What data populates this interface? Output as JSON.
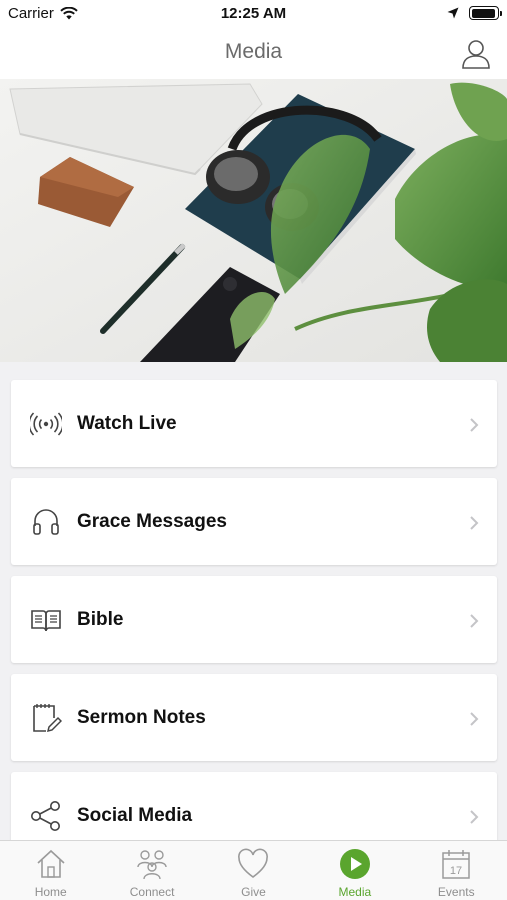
{
  "status_bar": {
    "carrier": "Carrier",
    "time": "12:25 AM",
    "battery_level": 0.95
  },
  "nav": {
    "title": "Media",
    "profile_icon": "person-icon"
  },
  "hero": {
    "image": "desk-flatlay-photo"
  },
  "menu": [
    {
      "label": "Watch Live",
      "icon": "broadcast-icon"
    },
    {
      "label": "Grace Messages",
      "icon": "headphones-icon"
    },
    {
      "label": "Bible",
      "icon": "open-book-icon"
    },
    {
      "label": "Sermon Notes",
      "icon": "notepad-pencil-icon"
    },
    {
      "label": "Social Media",
      "icon": "share-icon"
    }
  ],
  "tabs": [
    {
      "label": "Home",
      "icon": "home-icon",
      "active": false
    },
    {
      "label": "Connect",
      "icon": "people-icon",
      "active": false
    },
    {
      "label": "Give",
      "icon": "heart-icon",
      "active": false
    },
    {
      "label": "Media",
      "icon": "play-circle-icon",
      "active": true
    },
    {
      "label": "Events",
      "icon": "calendar-icon",
      "active": false
    }
  ],
  "colors": {
    "accent": "#5aa52e",
    "inactive": "#8e8e8e",
    "title_gray": "#6b6b6b"
  }
}
